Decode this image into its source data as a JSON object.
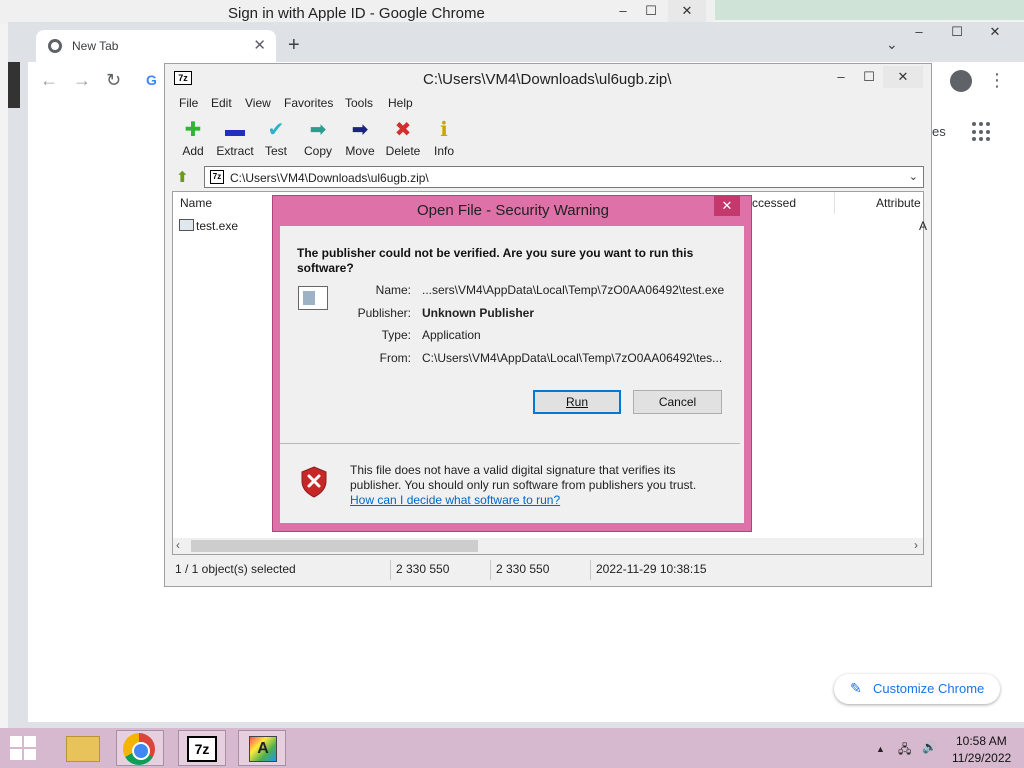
{
  "background_window": {
    "title": "Sign in with Apple ID - Google Chrome",
    "minimize": "–",
    "maximize": "☐",
    "close": "✕"
  },
  "chrome": {
    "tab_title": "New Tab",
    "tab_close": "✕",
    "new_tab": "+",
    "tab_list": "⌄",
    "back": "←",
    "forward": "→",
    "reload": "↻",
    "omnibox_g": "G",
    "apps_label": "es",
    "menu": "⋮",
    "customize_label": "Customize Chrome",
    "customize_icon": "✎",
    "minimize": "–",
    "maximize": "☐",
    "close": "✕"
  },
  "sevenzip": {
    "icon_text": "7z",
    "title": "C:\\Users\\VM4\\Downloads\\ul6ugb.zip\\",
    "minimize": "–",
    "maximize": "☐",
    "close": "✕",
    "menu": [
      "File",
      "Edit",
      "View",
      "Favorites",
      "Tools",
      "Help"
    ],
    "toolbar": [
      {
        "label": "Add",
        "icon": "plus-icon",
        "glyph": "✚",
        "color": "#2fb52f"
      },
      {
        "label": "Extract",
        "icon": "minus-icon",
        "glyph": "▬",
        "color": "#1f2fbf"
      },
      {
        "label": "Test",
        "icon": "check-icon",
        "glyph": "✔",
        "color": "#2bb3c8"
      },
      {
        "label": "Copy",
        "icon": "double-arrow-icon",
        "glyph": "➡",
        "color": "#2a9d8f"
      },
      {
        "label": "Move",
        "icon": "arrow-right-icon",
        "glyph": "➡",
        "color": "#1a237e"
      },
      {
        "label": "Delete",
        "icon": "delete-x-icon",
        "glyph": "✖",
        "color": "#d32f2f"
      },
      {
        "label": "Info",
        "icon": "info-icon",
        "glyph": "ℹ",
        "color": "#c9a400"
      }
    ],
    "address": "C:\\Users\\VM4\\Downloads\\ul6ugb.zip\\",
    "address_icon_text": "7z",
    "address_dropdown": "⌄",
    "up_icon": "⬆",
    "columns": {
      "name": "Name",
      "accessed": "ccessed",
      "attributes": "Attribute"
    },
    "files": [
      {
        "name": "test.exe",
        "attr": "A"
      }
    ],
    "scroll_left": "‹",
    "scroll_right": "›",
    "status": {
      "selected": "1 / 1 object(s) selected",
      "size": "2 330 550",
      "packed": "2 330 550",
      "modified": "2022-11-29 10:38:15"
    }
  },
  "dialog": {
    "title": "Open File - Security Warning",
    "close": "✕",
    "question": "The publisher could not be verified.  Are you sure you want to run this software?",
    "labels": {
      "name": "Name:",
      "publisher": "Publisher:",
      "type": "Type:",
      "from": "From:"
    },
    "values": {
      "name": "...sers\\VM4\\AppData\\Local\\Temp\\7zO0AA06492\\test.exe",
      "publisher": "Unknown Publisher",
      "type": "Application",
      "from": "C:\\Users\\VM4\\AppData\\Local\\Temp\\7zO0AA06492\\tes..."
    },
    "run": "Run",
    "cancel": "Cancel",
    "warning": "This file does not have a valid digital signature that verifies its publisher.  You should only run software from publishers you trust.",
    "link": "How can I decide what software to run?"
  },
  "taskbar": {
    "sevenzip_label": "7z",
    "app_label": "A",
    "tray_up": "▲",
    "tray_network": "🖧",
    "tray_volume": "🔊",
    "time": "10:58 AM",
    "date": "11/29/2022"
  }
}
